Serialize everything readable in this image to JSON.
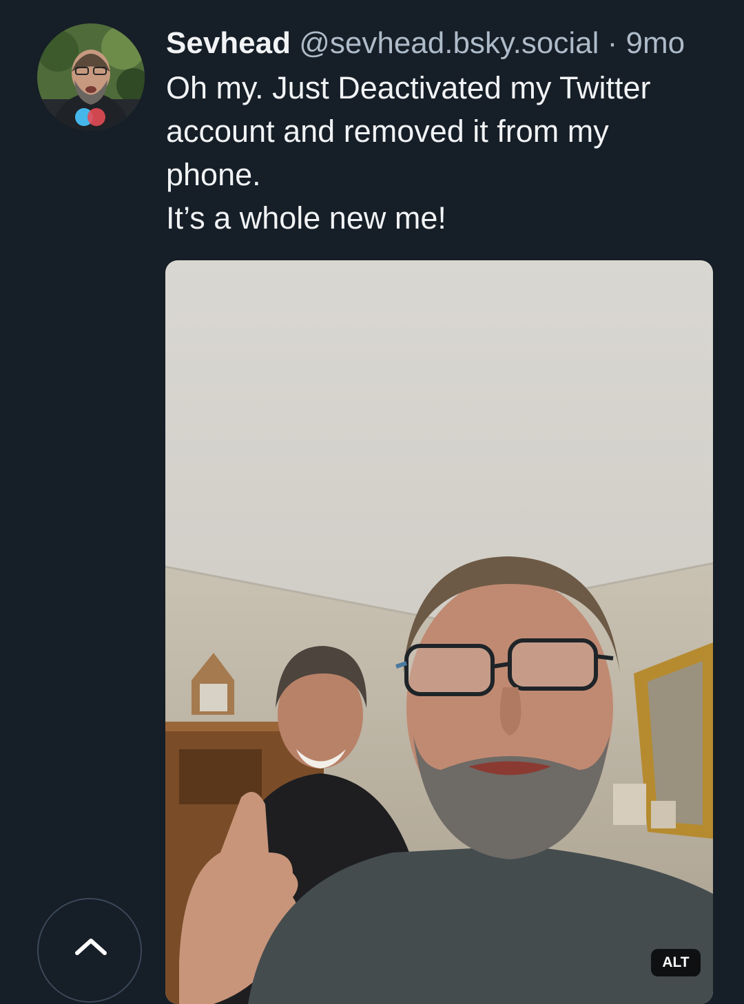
{
  "post": {
    "author": {
      "display_name": "Sevhead",
      "handle": "@sevhead.bsky.social",
      "separator": "·",
      "time": "9mo"
    },
    "text_lines": [
      "Oh my. Just Deactivated my Twitter",
      "account and removed it from my",
      "phone.",
      "It’s a whole new me!"
    ],
    "media": {
      "alt_label": "ALT"
    }
  },
  "icons": {
    "scroll_top": "chevron-up-icon"
  },
  "colors": {
    "background": "#161e27",
    "text_primary": "#f1f3f5",
    "text_secondary": "#aebbc9"
  }
}
